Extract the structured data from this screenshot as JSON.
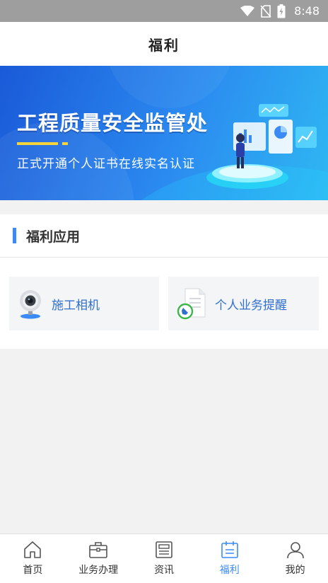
{
  "status_bar": {
    "time": "8:48"
  },
  "header": {
    "title": "福利"
  },
  "banner": {
    "headline": "工程质量安全监管处",
    "subline": "正式开通个人证书在线实名认证",
    "colors": {
      "accent_line": "#f5d33b"
    }
  },
  "section": {
    "title": "福利应用",
    "apps": [
      {
        "label": "施工相机",
        "icon": "webcam-icon"
      },
      {
        "label": "个人业务提醒",
        "icon": "document-pen-icon"
      }
    ]
  },
  "bottom_nav": {
    "items": [
      {
        "label": "首页",
        "icon": "home-icon"
      },
      {
        "label": "业务办理",
        "icon": "briefcase-icon"
      },
      {
        "label": "资讯",
        "icon": "news-icon"
      },
      {
        "label": "福利",
        "icon": "calendar-icon",
        "active": true
      },
      {
        "label": "我的",
        "icon": "user-icon"
      }
    ],
    "active_color": "#3b8bf6"
  }
}
